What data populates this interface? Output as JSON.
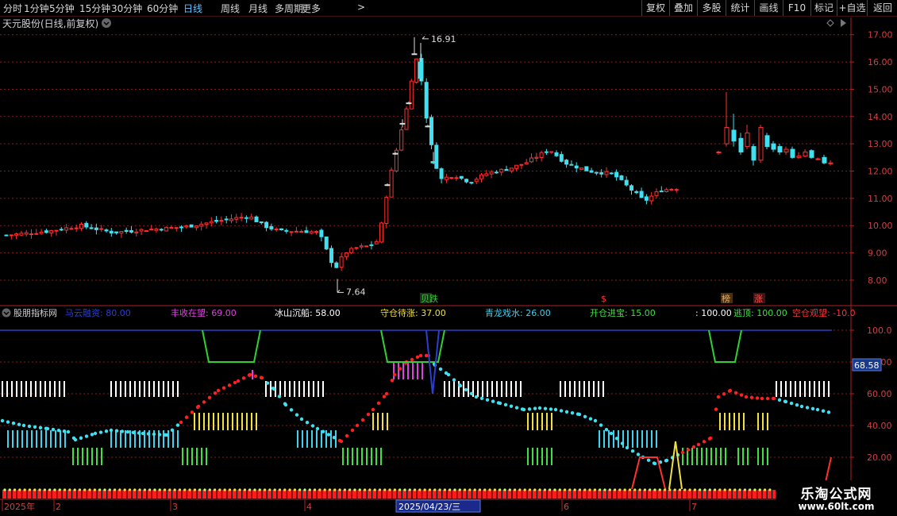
{
  "toolbar": {
    "periods": [
      "分时",
      "1分钟",
      "5分钟",
      "15分钟",
      "30分钟",
      "60分钟",
      "日线",
      "周线",
      "月线",
      "多周期",
      "更多"
    ],
    "active_period": "日线",
    "more_arrow": ">",
    "right_buttons": [
      "复权",
      "叠加",
      "多股",
      "统计",
      "画线",
      "F10",
      "标记",
      "+自选",
      "返回"
    ]
  },
  "price_panel": {
    "title": "天元股份(日线,前复权)",
    "dropdown_icon": "circle-chevron-down-icon",
    "high_label": "16.91",
    "low_label": "7.64",
    "y_ticks": [
      "17.00",
      "16.00",
      "15.00",
      "14.00",
      "13.00",
      "12.00",
      "11.00",
      "10.00",
      "9.00",
      "8.00"
    ],
    "markers": [
      {
        "text": "贝跌",
        "color": "#3ec93e"
      },
      {
        "text": "$",
        "color": "#ff3030"
      },
      {
        "text": "榜",
        "color": "#e0b070"
      },
      {
        "text": "涨",
        "color": "#ff5050"
      }
    ]
  },
  "indicator_panel": {
    "name": "股朋指标网",
    "legend": [
      {
        "label": "马云融资: 80.00",
        "color": "#2b3fd0"
      },
      {
        "label": "丰收在望: 69.00",
        "color": "#e040e0"
      },
      {
        "label": "冰山沉船: 58.00",
        "color": "#ffffff"
      },
      {
        "label": "守仓待涨: 37.00",
        "color": "#f0e040"
      },
      {
        "label": "青龙戏水: 26.00",
        "color": "#40d0f0"
      },
      {
        "label": "开仓进宝: 15.00",
        "color": "#40e040"
      },
      {
        "label": ": 100.00",
        "color": "#ffffff"
      },
      {
        "label": "逃顶: 100.00",
        "color": "#40e040"
      },
      {
        "label": "空仓观望: -10.0",
        "color": "#ff3030"
      }
    ],
    "y_ticks": [
      "100.0",
      "80.00",
      "60.00",
      "40.00",
      "20.00"
    ],
    "current_value": "68.58"
  },
  "date_axis": {
    "labels": [
      "2025年",
      "2",
      "3",
      "4",
      "5",
      "6",
      "7"
    ],
    "cursor_date": "2025/04/23/三"
  },
  "watermark": {
    "title": "乐淘公式网",
    "url": "www.60lt.com"
  },
  "chart_data": {
    "type": "candlestick",
    "price_ylim": [
      7.3,
      17.4
    ],
    "indicator_ylim": [
      -5,
      105
    ],
    "price_range": {
      "high": 16.91,
      "low": 7.64
    },
    "colors": {
      "up": "#ff3030",
      "down": "#40e0f0",
      "grid": "#8a1a1a"
    }
  }
}
